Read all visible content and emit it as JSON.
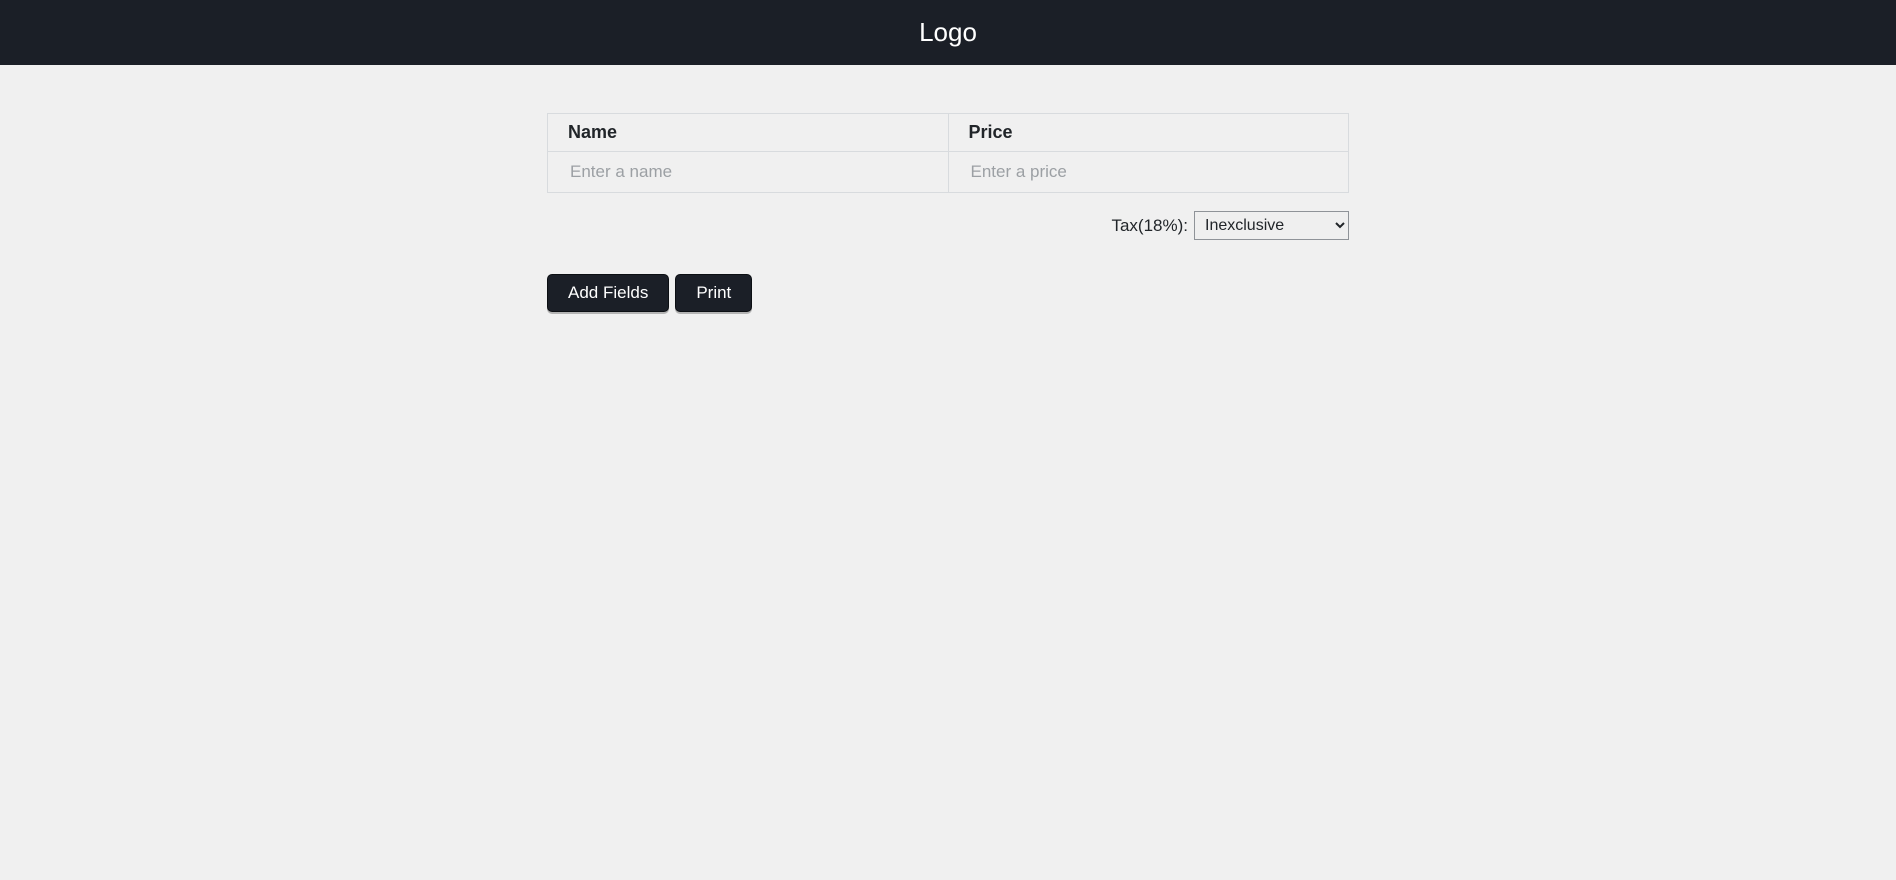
{
  "header": {
    "brand": "Logo"
  },
  "table": {
    "headers": {
      "name": "Name",
      "price": "Price"
    },
    "rows": [
      {
        "name_value": "",
        "name_placeholder": "Enter a name",
        "price_value": "",
        "price_placeholder": "Enter a price"
      }
    ]
  },
  "tax": {
    "label": "Tax(18%):",
    "selected": "Inexclusive"
  },
  "buttons": {
    "add_fields": "Add Fields",
    "print": "Print"
  }
}
